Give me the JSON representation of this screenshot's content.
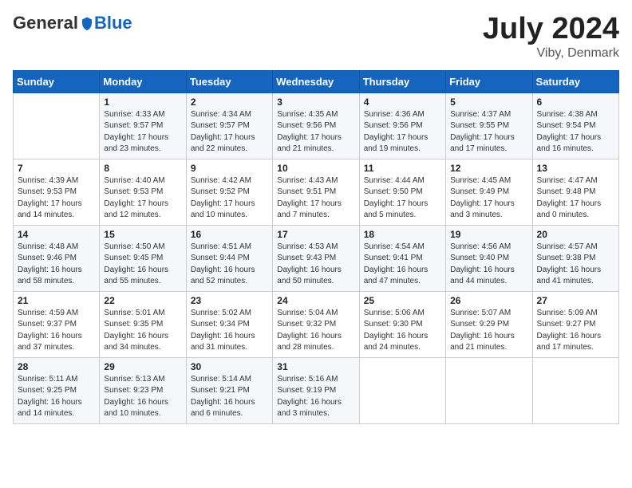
{
  "header": {
    "logo_general": "General",
    "logo_blue": "Blue",
    "month_year": "July 2024",
    "location": "Viby, Denmark"
  },
  "days_of_week": [
    "Sunday",
    "Monday",
    "Tuesday",
    "Wednesday",
    "Thursday",
    "Friday",
    "Saturday"
  ],
  "weeks": [
    [
      {
        "day": "",
        "info": ""
      },
      {
        "day": "1",
        "info": "Sunrise: 4:33 AM\nSunset: 9:57 PM\nDaylight: 17 hours\nand 23 minutes."
      },
      {
        "day": "2",
        "info": "Sunrise: 4:34 AM\nSunset: 9:57 PM\nDaylight: 17 hours\nand 22 minutes."
      },
      {
        "day": "3",
        "info": "Sunrise: 4:35 AM\nSunset: 9:56 PM\nDaylight: 17 hours\nand 21 minutes."
      },
      {
        "day": "4",
        "info": "Sunrise: 4:36 AM\nSunset: 9:56 PM\nDaylight: 17 hours\nand 19 minutes."
      },
      {
        "day": "5",
        "info": "Sunrise: 4:37 AM\nSunset: 9:55 PM\nDaylight: 17 hours\nand 17 minutes."
      },
      {
        "day": "6",
        "info": "Sunrise: 4:38 AM\nSunset: 9:54 PM\nDaylight: 17 hours\nand 16 minutes."
      }
    ],
    [
      {
        "day": "7",
        "info": "Sunrise: 4:39 AM\nSunset: 9:53 PM\nDaylight: 17 hours\nand 14 minutes."
      },
      {
        "day": "8",
        "info": "Sunrise: 4:40 AM\nSunset: 9:53 PM\nDaylight: 17 hours\nand 12 minutes."
      },
      {
        "day": "9",
        "info": "Sunrise: 4:42 AM\nSunset: 9:52 PM\nDaylight: 17 hours\nand 10 minutes."
      },
      {
        "day": "10",
        "info": "Sunrise: 4:43 AM\nSunset: 9:51 PM\nDaylight: 17 hours\nand 7 minutes."
      },
      {
        "day": "11",
        "info": "Sunrise: 4:44 AM\nSunset: 9:50 PM\nDaylight: 17 hours\nand 5 minutes."
      },
      {
        "day": "12",
        "info": "Sunrise: 4:45 AM\nSunset: 9:49 PM\nDaylight: 17 hours\nand 3 minutes."
      },
      {
        "day": "13",
        "info": "Sunrise: 4:47 AM\nSunset: 9:48 PM\nDaylight: 17 hours\nand 0 minutes."
      }
    ],
    [
      {
        "day": "14",
        "info": "Sunrise: 4:48 AM\nSunset: 9:46 PM\nDaylight: 16 hours\nand 58 minutes."
      },
      {
        "day": "15",
        "info": "Sunrise: 4:50 AM\nSunset: 9:45 PM\nDaylight: 16 hours\nand 55 minutes."
      },
      {
        "day": "16",
        "info": "Sunrise: 4:51 AM\nSunset: 9:44 PM\nDaylight: 16 hours\nand 52 minutes."
      },
      {
        "day": "17",
        "info": "Sunrise: 4:53 AM\nSunset: 9:43 PM\nDaylight: 16 hours\nand 50 minutes."
      },
      {
        "day": "18",
        "info": "Sunrise: 4:54 AM\nSunset: 9:41 PM\nDaylight: 16 hours\nand 47 minutes."
      },
      {
        "day": "19",
        "info": "Sunrise: 4:56 AM\nSunset: 9:40 PM\nDaylight: 16 hours\nand 44 minutes."
      },
      {
        "day": "20",
        "info": "Sunrise: 4:57 AM\nSunset: 9:38 PM\nDaylight: 16 hours\nand 41 minutes."
      }
    ],
    [
      {
        "day": "21",
        "info": "Sunrise: 4:59 AM\nSunset: 9:37 PM\nDaylight: 16 hours\nand 37 minutes."
      },
      {
        "day": "22",
        "info": "Sunrise: 5:01 AM\nSunset: 9:35 PM\nDaylight: 16 hours\nand 34 minutes."
      },
      {
        "day": "23",
        "info": "Sunrise: 5:02 AM\nSunset: 9:34 PM\nDaylight: 16 hours\nand 31 minutes."
      },
      {
        "day": "24",
        "info": "Sunrise: 5:04 AM\nSunset: 9:32 PM\nDaylight: 16 hours\nand 28 minutes."
      },
      {
        "day": "25",
        "info": "Sunrise: 5:06 AM\nSunset: 9:30 PM\nDaylight: 16 hours\nand 24 minutes."
      },
      {
        "day": "26",
        "info": "Sunrise: 5:07 AM\nSunset: 9:29 PM\nDaylight: 16 hours\nand 21 minutes."
      },
      {
        "day": "27",
        "info": "Sunrise: 5:09 AM\nSunset: 9:27 PM\nDaylight: 16 hours\nand 17 minutes."
      }
    ],
    [
      {
        "day": "28",
        "info": "Sunrise: 5:11 AM\nSunset: 9:25 PM\nDaylight: 16 hours\nand 14 minutes."
      },
      {
        "day": "29",
        "info": "Sunrise: 5:13 AM\nSunset: 9:23 PM\nDaylight: 16 hours\nand 10 minutes."
      },
      {
        "day": "30",
        "info": "Sunrise: 5:14 AM\nSunset: 9:21 PM\nDaylight: 16 hours\nand 6 minutes."
      },
      {
        "day": "31",
        "info": "Sunrise: 5:16 AM\nSunset: 9:19 PM\nDaylight: 16 hours\nand 3 minutes."
      },
      {
        "day": "",
        "info": ""
      },
      {
        "day": "",
        "info": ""
      },
      {
        "day": "",
        "info": ""
      }
    ]
  ]
}
